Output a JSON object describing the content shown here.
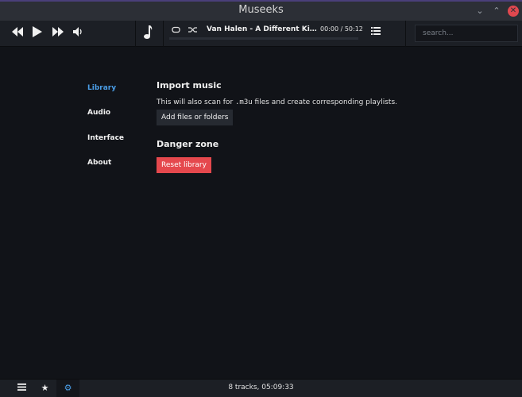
{
  "window": {
    "title": "Museeks"
  },
  "player": {
    "track": "Van Halen - A Different Kind Of Truth",
    "time": "00:00 / 50:12",
    "progress": 0
  },
  "search": {
    "placeholder": "search..."
  },
  "settings_nav": {
    "items": [
      {
        "label": "Library",
        "active": true
      },
      {
        "label": "Audio",
        "active": false
      },
      {
        "label": "Interface",
        "active": false
      },
      {
        "label": "About",
        "active": false
      }
    ]
  },
  "library": {
    "import_title": "Import music",
    "import_desc_before": "This will also scan for ",
    "import_desc_code": ".m3u",
    "import_desc_after": " files and create corresponding playlists.",
    "add_button": "Add files or folders",
    "danger_title": "Danger zone",
    "reset_button": "Reset library"
  },
  "footer": {
    "status": "8 tracks, 05:09:33"
  },
  "icons": {
    "previous": "previous-icon",
    "play": "play-icon",
    "next": "next-icon",
    "volume": "volume-icon",
    "note": "music-note-icon",
    "repeat": "repeat-icon",
    "shuffle": "shuffle-icon",
    "queue": "queue-icon",
    "library": "list-icon",
    "playlists": "star-icon",
    "settings": "gear-icon"
  },
  "colors": {
    "accent": "#4a9de6",
    "danger": "#e5484d",
    "background": "#111318",
    "bar": "#1c1f25"
  }
}
